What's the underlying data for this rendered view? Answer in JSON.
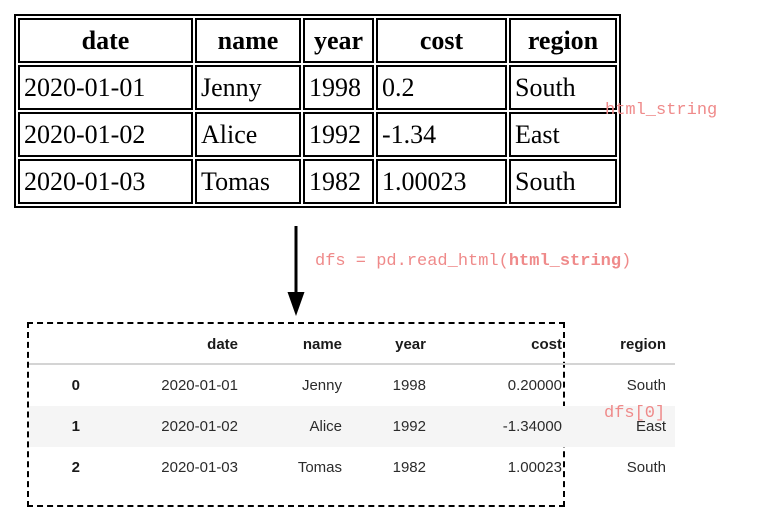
{
  "raw_table": {
    "headers": [
      "date",
      "name",
      "year",
      "cost",
      "region"
    ],
    "rows": [
      [
        "2020-01-01",
        "Jenny",
        "1998",
        "0.2",
        "South"
      ],
      [
        "2020-01-02",
        "Alice",
        "1992",
        "-1.34",
        "East"
      ],
      [
        "2020-01-03",
        "Tomas",
        "1982",
        "1.00023",
        "South"
      ]
    ],
    "label": "html_string"
  },
  "flow": {
    "arrow_direction": "down",
    "code_prefix": "dfs = pd.read_html(",
    "code_arg": "html_string",
    "code_suffix": ")"
  },
  "dataframe": {
    "label": "dfs[0]",
    "index_header": "",
    "headers": [
      "date",
      "name",
      "year",
      "cost",
      "region"
    ],
    "index": [
      "0",
      "1",
      "2"
    ],
    "rows": [
      [
        "2020-01-01",
        "Jenny",
        "1998",
        "0.20000",
        "South"
      ],
      [
        "2020-01-02",
        "Alice",
        "1992",
        "-1.34000",
        "East"
      ],
      [
        "2020-01-03",
        "Tomas",
        "1982",
        "1.00023",
        "South"
      ]
    ],
    "striped_row_index": 1
  },
  "colors": {
    "code_text": "#ef8a8a",
    "border": "#000000",
    "stripe": "#f5f5f5",
    "header_rule": "#d4d4d4",
    "text": "#2b2b2b"
  }
}
